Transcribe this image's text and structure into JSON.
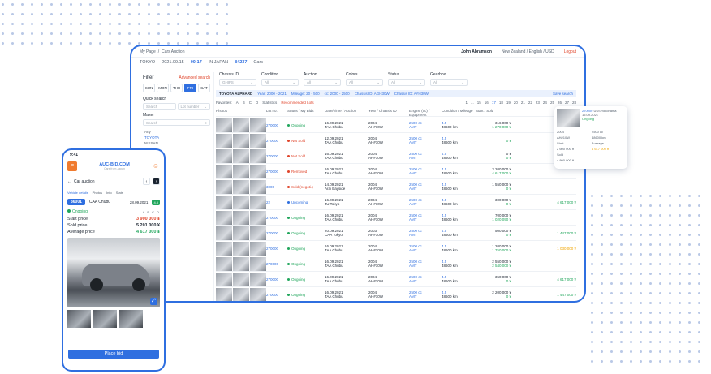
{
  "desktop": {
    "breadcrumb": [
      "My Page",
      "Cars Auction"
    ],
    "user": "John Abramson",
    "region": "New Zealand / English / USD",
    "logout": "Logout",
    "info": {
      "city": "TOKYO",
      "date": "2021.09.15",
      "time": "00:17",
      "japan": "IN JAPAN",
      "count": "84237",
      "unit": "Cars"
    },
    "filter": {
      "title": "Filter",
      "advanced": "Advanced search",
      "days": [
        "SUN",
        "MON",
        "THU",
        "FRI",
        "SAT"
      ],
      "quick_search": "Quick search",
      "search_placeholder": "Search",
      "lot_number": "Lot number",
      "maker_label": "Maker",
      "maker_search": "Search",
      "makers": [
        "Any",
        "TOYOTA",
        "NISSAN"
      ]
    },
    "top_filters": [
      {
        "label": "Chassis ID",
        "value": "GHIFS"
      },
      {
        "label": "Condition",
        "value": "All"
      },
      {
        "label": "Auction",
        "value": "All"
      },
      {
        "label": "Colors",
        "value": "All"
      },
      {
        "label": "Status",
        "value": "All"
      },
      {
        "label": "Gearbox",
        "value": "All"
      }
    ],
    "strip": {
      "title": "TOYOTA ALPHARD",
      "year": "Year: 2000 - 2021",
      "mileage": "Mileage: 20 - 500",
      "cc": "cc: 2000 - 2500",
      "chassis": "Chassis ID: AGH30W",
      "chassis2": "Chassis ID: AYH30W",
      "save": "Save search"
    },
    "sub": {
      "fav": "Favorites:",
      "grades": [
        "A",
        "B",
        "C",
        "D"
      ],
      "stats": "Statistics",
      "recommended": "Recommended Lots",
      "pages": [
        "1",
        "...",
        "15",
        "16",
        "17",
        "18",
        "19",
        "20",
        "21",
        "22",
        "23",
        "24",
        "25",
        "26",
        "27",
        "28"
      ]
    },
    "headers": [
      "Photos",
      "Lot no.",
      "Status / My Bids",
      "Date/Time / Auction",
      "Year / Chassis ID",
      "Engine (cc) / Equipment",
      "Condition / Mileage",
      "Start / Sold"
    ],
    "rows": [
      {
        "lot": "270000",
        "status": "Ongoing",
        "st": "g",
        "date": "16.09.2021",
        "auction": "TAA Chubu",
        "year": "2004",
        "model": "AH#10W",
        "equip": "AMT",
        "eng": "2500 cc",
        "cond": "4.5",
        "mil": "48600 km",
        "start": "316 000 ¥",
        "sold": "1 270 000 ¥",
        "so": "g"
      },
      {
        "lot": "270000",
        "status": "Not Sold",
        "st": "r",
        "date": "12.09.2021",
        "auction": "TAA Chubu",
        "year": "2004",
        "model": "AH#10W",
        "equip": "AMT",
        "eng": "2500 cc",
        "cond": "4.5",
        "mil": "48600 km",
        "start": "",
        "sold": "0 ¥",
        "so": "g"
      },
      {
        "lot": "270000",
        "status": "Not Sold",
        "st": "r",
        "date": "16.09.2021",
        "auction": "TAA Chubu",
        "year": "2004",
        "model": "AH#10W",
        "equip": "AMT",
        "eng": "2500 cc",
        "cond": "4.5",
        "mil": "48600 km",
        "start": "0 ¥",
        "sold": "0 ¥",
        "so": "g"
      },
      {
        "lot": "270000",
        "status": "Removed",
        "st": "r",
        "date": "16.09.2021",
        "auction": "TAA Chubu",
        "year": "2004",
        "model": "AH#10W",
        "equip": "AMT",
        "eng": "2500 cc",
        "cond": "4.5",
        "mil": "48600 km",
        "start": "3 200 000 ¥",
        "sold": "4 617 000 ¥",
        "so": "g"
      },
      {
        "lot": "3000",
        "status": "Sold (negoti.)",
        "st": "r",
        "date": "14.09.2021",
        "auction": "Arai Bayside",
        "year": "2004",
        "model": "AH#10W",
        "equip": "AMT",
        "eng": "2500 cc",
        "cond": "4.5",
        "mil": "48600 km",
        "start": "1 550 000 ¥",
        "sold": "0 ¥",
        "so": "g"
      },
      {
        "lot": "22",
        "status": "Upcoming",
        "st": "b",
        "date": "16.09.2021",
        "auction": "JU Tokyo",
        "year": "2004",
        "model": "AH#10W",
        "equip": "AMT",
        "eng": "2500 cc",
        "cond": "4.5",
        "mil": "48600 km",
        "start": "300 000 ¥",
        "sold": "0 ¥",
        "so": "g"
      },
      {
        "lot": "270000",
        "status": "Ongoing",
        "st": "g",
        "date": "16.09.2021",
        "auction": "TAA Chubu",
        "year": "2004",
        "model": "AH#10W",
        "equip": "AMT",
        "eng": "2500 cc",
        "cond": "4.5",
        "mil": "48600 km",
        "start": "700 000 ¥",
        "sold": "1 020 090 ¥",
        "so": "g"
      },
      {
        "lot": "270000",
        "status": "Ongoing",
        "st": "g",
        "date": "20.09.2021",
        "auction": "CAA Tokyo",
        "year": "2003",
        "model": "AH#10W",
        "equip": "AMT",
        "eng": "2500 cc",
        "cond": "4.5",
        "mil": "48600 km",
        "start": "500 000 ¥",
        "sold": "0 ¥",
        "so": "g"
      },
      {
        "lot": "270000",
        "status": "Ongoing",
        "st": "g",
        "date": "16.09.2021",
        "auction": "TAA Chubu",
        "year": "2004",
        "model": "AH#10W",
        "equip": "AMT",
        "eng": "2500 cc",
        "cond": "4.5",
        "mil": "48600 km",
        "start": "1 200 000 ¥",
        "sold": "1 750 000 ¥",
        "so": "g"
      },
      {
        "lot": "270000",
        "status": "Ongoing",
        "st": "g",
        "date": "16.09.2021",
        "auction": "TAA Chubu",
        "year": "2004",
        "model": "AH#10W",
        "equip": "AMT",
        "eng": "2500 cc",
        "cond": "4.5",
        "mil": "48600 km",
        "start": "2 550 000 ¥",
        "sold": "2 540 000 ¥",
        "so": "g"
      },
      {
        "lot": "270000",
        "status": "Ongoing",
        "st": "g",
        "date": "16.09.2021",
        "auction": "TAA Chubu",
        "year": "2004",
        "model": "AH#10W",
        "equip": "AMT",
        "eng": "2500 cc",
        "cond": "4.5",
        "mil": "48600 km",
        "start": "350 000 ¥",
        "sold": "0 ¥",
        "so": "g"
      },
      {
        "lot": "270000",
        "status": "Ongoing",
        "st": "g",
        "date": "16.09.2021",
        "auction": "TAA Chubu",
        "year": "2004",
        "model": "AH#10W",
        "equip": "AMT",
        "eng": "2500 cc",
        "cond": "4.5",
        "mil": "48600 km",
        "start": "2 200 000 ¥",
        "sold": "0 ¥",
        "so": "g"
      }
    ],
    "side_sold": [
      "",
      "",
      "",
      "",
      "",
      "4 617 000 ¥",
      "",
      "1 447 000 ¥",
      "1 030 000 ¥",
      "",
      "4 617 000 ¥",
      "1 447 000 ¥"
    ],
    "popup": {
      "lot": "270000",
      "auction": "USS Yokohama",
      "date": "15.09.2021",
      "status": "Ongoing",
      "year": "2004",
      "model": "AH#10W",
      "eng": "2500 cc",
      "cond": "4.5",
      "mil": "48600 km",
      "start_l": "Start",
      "sold_l": "Sold",
      "avg_l": "Average",
      "start": "2 600 000 ¥",
      "sold": "4 800 000 ¥",
      "avg": "4 617 000 ¥"
    }
  },
  "mobile": {
    "time": "9:41",
    "logo": "AUC-BID.COM",
    "logo_sub": "Cars from Japan",
    "back": "Car auction",
    "prev": "‹",
    "next": "›",
    "tabs": [
      "Vehicle details",
      "Photos",
      "Info",
      "Stats"
    ],
    "lot": "36001",
    "auction": "CAA Chubu",
    "date": "28.09.2021",
    "time2": "(16:24)",
    "grade": "4.5",
    "status": "Ongoing",
    "options": "A  B  C  D",
    "start_label": "Start price",
    "start": "3 900 000 ¥",
    "sold_label": "Sold price",
    "sold": "5 201 000 ¥",
    "avg_label": "Average price",
    "avg": "4 617 000 ¥",
    "bid_button": "Place bid"
  },
  "colors": {
    "accent": "#2f6fe0",
    "warn": "#e0452b",
    "ok": "#21a65c",
    "orange": "#f07b2f"
  }
}
